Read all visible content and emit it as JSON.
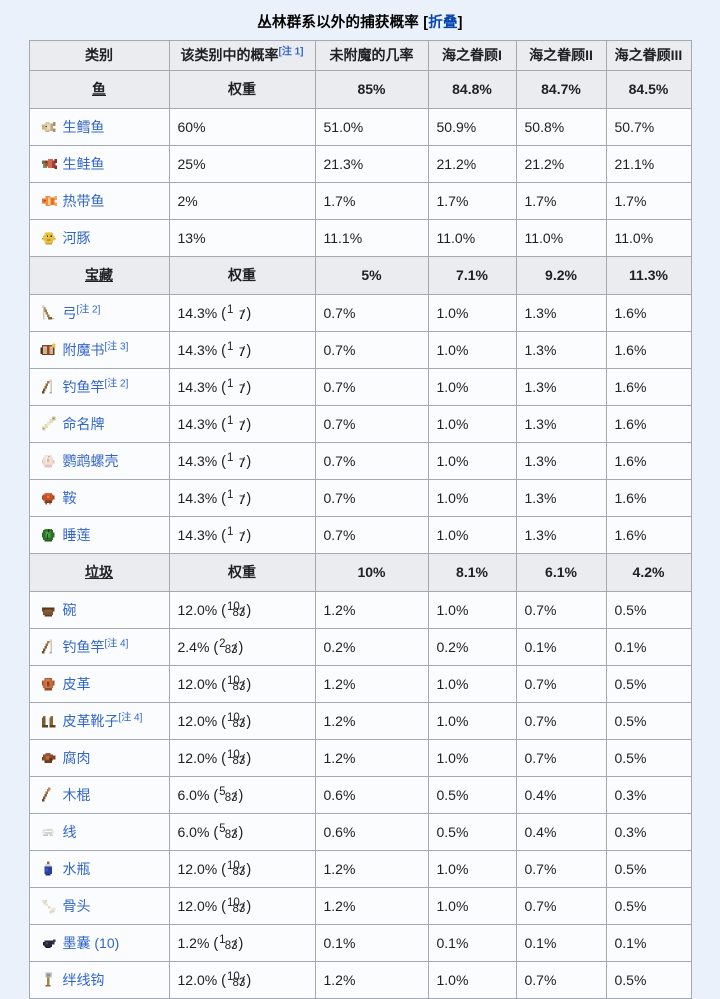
{
  "caption": {
    "title": "丛林群系以外的捕获概率",
    "bracket_open": "[",
    "collapse_label": "折叠",
    "bracket_close": "]"
  },
  "colors": {
    "page_background": "#eaf1fb",
    "table_background": "#fbfcfd",
    "header_background": "#eaecf0",
    "border": "#a2a9b1",
    "link": "#3366cc",
    "caption_link": "#0645ad",
    "text": "#202122"
  },
  "table": {
    "headers": [
      {
        "label": "类别",
        "note": ""
      },
      {
        "label": "该类别中的概率",
        "note": "[注 1]"
      },
      {
        "label": "未附魔的几率",
        "note": ""
      },
      {
        "label": "海之眷顾I",
        "note": ""
      },
      {
        "label": "海之眷顾II",
        "note": ""
      },
      {
        "label": "海之眷顾III",
        "note": ""
      }
    ],
    "groups": [
      {
        "name": "鱼",
        "weight_label": "权重",
        "totals": [
          "85%",
          "84.8%",
          "84.7%",
          "84.5%"
        ],
        "rows": [
          {
            "icon": "raw-cod-icon",
            "item": "生鳕鱼",
            "note": "",
            "weight": "60%",
            "weight_frac": null,
            "values": [
              "51.0%",
              "50.9%",
              "50.8%",
              "50.7%"
            ]
          },
          {
            "icon": "raw-salmon-icon",
            "item": "生鲑鱼",
            "note": "",
            "weight": "25%",
            "weight_frac": null,
            "values": [
              "21.3%",
              "21.2%",
              "21.2%",
              "21.1%"
            ]
          },
          {
            "icon": "tropical-fish-icon",
            "item": "热带鱼",
            "note": "",
            "weight": "2%",
            "weight_frac": null,
            "values": [
              "1.7%",
              "1.7%",
              "1.7%",
              "1.7%"
            ]
          },
          {
            "icon": "pufferfish-icon",
            "item": "河豚",
            "note": "",
            "weight": "13%",
            "weight_frac": null,
            "values": [
              "11.1%",
              "11.0%",
              "11.0%",
              "11.0%"
            ]
          }
        ]
      },
      {
        "name": "宝藏",
        "weight_label": "权重",
        "totals": [
          "5%",
          "7.1%",
          "9.2%",
          "11.3%"
        ],
        "rows": [
          {
            "icon": "bow-icon",
            "item": "弓",
            "note": "[注 2]",
            "weight": "14.3%",
            "weight_frac": {
              "num": "1",
              "den": "7"
            },
            "values": [
              "0.7%",
              "1.0%",
              "1.3%",
              "1.6%"
            ]
          },
          {
            "icon": "enchanted-book-icon",
            "item": "附魔书",
            "note": "[注 3]",
            "weight": "14.3%",
            "weight_frac": {
              "num": "1",
              "den": "7"
            },
            "values": [
              "0.7%",
              "1.0%",
              "1.3%",
              "1.6%"
            ]
          },
          {
            "icon": "fishing-rod-icon",
            "item": "钓鱼竿",
            "note": "[注 2]",
            "weight": "14.3%",
            "weight_frac": {
              "num": "1",
              "den": "7"
            },
            "values": [
              "0.7%",
              "1.0%",
              "1.3%",
              "1.6%"
            ]
          },
          {
            "icon": "name-tag-icon",
            "item": "命名牌",
            "note": "",
            "weight": "14.3%",
            "weight_frac": {
              "num": "1",
              "den": "7"
            },
            "values": [
              "0.7%",
              "1.0%",
              "1.3%",
              "1.6%"
            ]
          },
          {
            "icon": "nautilus-shell-icon",
            "item": "鹦鹉螺壳",
            "note": "",
            "weight": "14.3%",
            "weight_frac": {
              "num": "1",
              "den": "7"
            },
            "values": [
              "0.7%",
              "1.0%",
              "1.3%",
              "1.6%"
            ]
          },
          {
            "icon": "saddle-icon",
            "item": "鞍",
            "note": "",
            "weight": "14.3%",
            "weight_frac": {
              "num": "1",
              "den": "7"
            },
            "values": [
              "0.7%",
              "1.0%",
              "1.3%",
              "1.6%"
            ]
          },
          {
            "icon": "lily-pad-icon",
            "item": "睡莲",
            "note": "",
            "weight": "14.3%",
            "weight_frac": {
              "num": "1",
              "den": "7"
            },
            "values": [
              "0.7%",
              "1.0%",
              "1.3%",
              "1.6%"
            ]
          }
        ]
      },
      {
        "name": "垃圾",
        "weight_label": "权重",
        "totals": [
          "10%",
          "8.1%",
          "6.1%",
          "4.2%"
        ],
        "rows": [
          {
            "icon": "bowl-icon",
            "item": "碗",
            "note": "",
            "weight": "12.0%",
            "weight_frac": {
              "num": "10",
              "den": "83"
            },
            "values": [
              "1.2%",
              "1.0%",
              "0.7%",
              "0.5%"
            ]
          },
          {
            "icon": "fishing-rod-icon",
            "item": "钓鱼竿",
            "note": "[注 4]",
            "weight": "2.4%",
            "weight_frac": {
              "num": "2",
              "den": "83"
            },
            "values": [
              "0.2%",
              "0.2%",
              "0.1%",
              "0.1%"
            ]
          },
          {
            "icon": "leather-icon",
            "item": "皮革",
            "note": "",
            "weight": "12.0%",
            "weight_frac": {
              "num": "10",
              "den": "83"
            },
            "values": [
              "1.2%",
              "1.0%",
              "0.7%",
              "0.5%"
            ]
          },
          {
            "icon": "leather-boots-icon",
            "item": "皮革靴子",
            "note": "[注 4]",
            "weight": "12.0%",
            "weight_frac": {
              "num": "10",
              "den": "83"
            },
            "values": [
              "1.2%",
              "1.0%",
              "0.7%",
              "0.5%"
            ]
          },
          {
            "icon": "rotten-flesh-icon",
            "item": "腐肉",
            "note": "",
            "weight": "12.0%",
            "weight_frac": {
              "num": "10",
              "den": "83"
            },
            "values": [
              "1.2%",
              "1.0%",
              "0.7%",
              "0.5%"
            ]
          },
          {
            "icon": "stick-icon",
            "item": "木棍",
            "note": "",
            "weight": "6.0%",
            "weight_frac": {
              "num": "5",
              "den": "83"
            },
            "values": [
              "0.6%",
              "0.5%",
              "0.4%",
              "0.3%"
            ]
          },
          {
            "icon": "string-icon",
            "item": "线",
            "note": "",
            "weight": "6.0%",
            "weight_frac": {
              "num": "5",
              "den": "83"
            },
            "values": [
              "0.6%",
              "0.5%",
              "0.4%",
              "0.3%"
            ]
          },
          {
            "icon": "water-bottle-icon",
            "item": "水瓶",
            "note": "",
            "weight": "12.0%",
            "weight_frac": {
              "num": "10",
              "den": "83"
            },
            "values": [
              "1.2%",
              "1.0%",
              "0.7%",
              "0.5%"
            ]
          },
          {
            "icon": "bone-icon",
            "item": "骨头",
            "note": "",
            "weight": "12.0%",
            "weight_frac": {
              "num": "10",
              "den": "83"
            },
            "values": [
              "1.2%",
              "1.0%",
              "0.7%",
              "0.5%"
            ]
          },
          {
            "icon": "ink-sac-icon",
            "item": "墨囊 (10)",
            "note": "",
            "weight": "1.2%",
            "weight_frac": {
              "num": "1",
              "den": "83"
            },
            "values": [
              "0.1%",
              "0.1%",
              "0.1%",
              "0.1%"
            ]
          },
          {
            "icon": "tripwire-hook-icon",
            "item": "绊线钩",
            "note": "",
            "weight": "12.0%",
            "weight_frac": {
              "num": "10",
              "den": "83"
            },
            "values": [
              "1.2%",
              "1.0%",
              "0.7%",
              "0.5%"
            ]
          }
        ]
      }
    ]
  }
}
